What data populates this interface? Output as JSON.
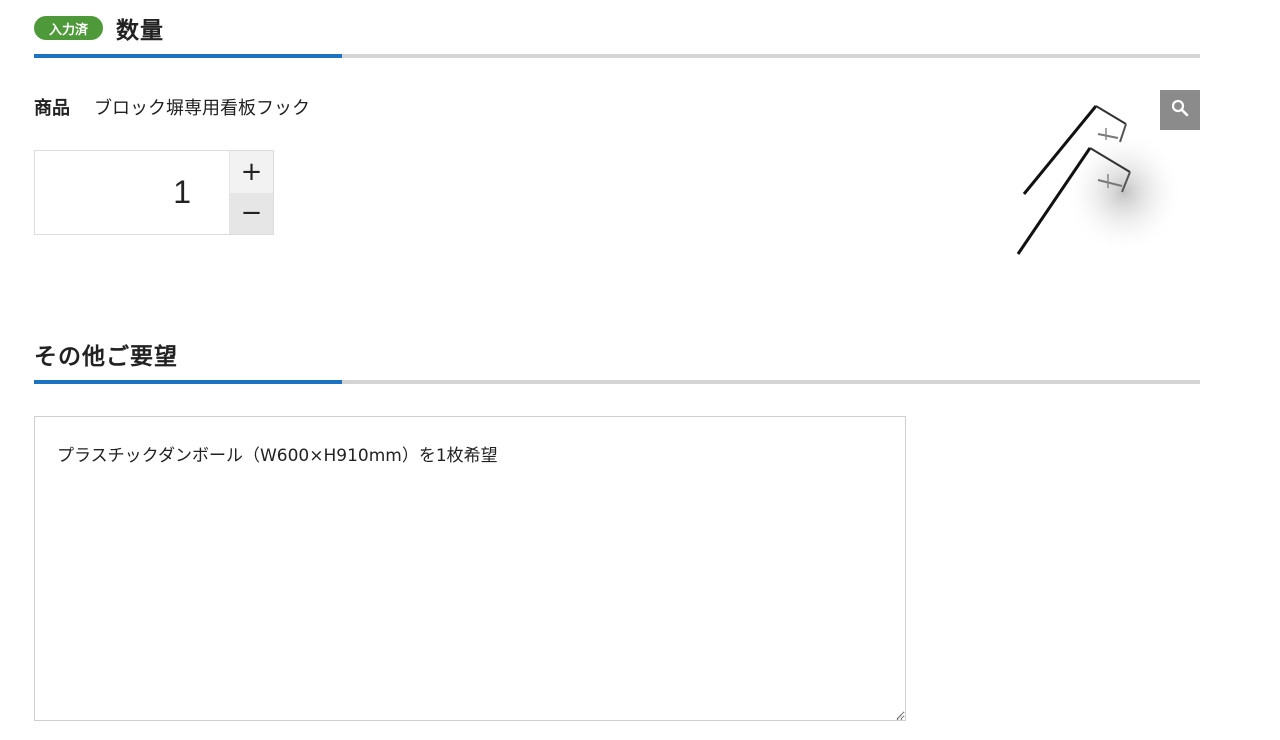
{
  "quantity_section": {
    "badge": "入力済",
    "title": "数量",
    "product_label": "商品",
    "product_name": "ブロック塀専用看板フック",
    "quantity": "1",
    "plus_label": "+",
    "minus_label": "−",
    "zoom_icon": "search-icon",
    "product_image_icon": "hook-product-image"
  },
  "other_section": {
    "title": "その他ご要望",
    "textarea_value": "プラスチックダンボール（W600×H910mm）を1枚希望"
  },
  "colors": {
    "badge_green": "#4e9a3a",
    "accent_blue": "#1c73c2",
    "rule_gray": "#d4d4d4",
    "zoom_gray": "#8b8b8b"
  }
}
